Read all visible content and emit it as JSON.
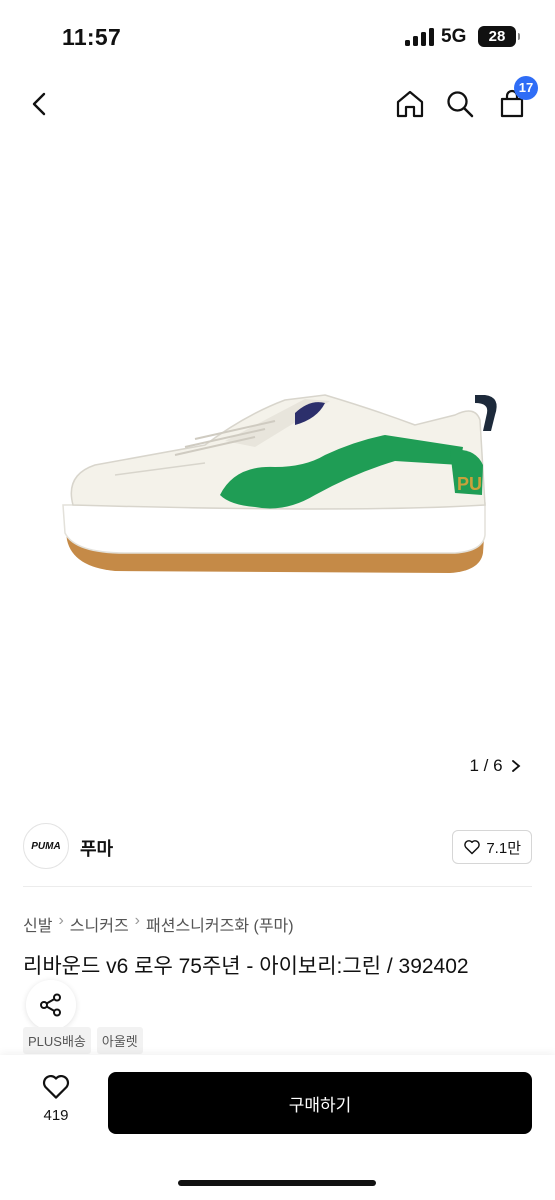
{
  "status_bar": {
    "time": "11:57",
    "network": "5G",
    "battery": "28"
  },
  "nav": {
    "cart_count": "17"
  },
  "image_pager": {
    "text": "1 / 6"
  },
  "brand": {
    "logo_text": "PUMA",
    "name": "푸마",
    "likes": "7.1만"
  },
  "breadcrumb": [
    "신발",
    "스니커즈",
    "패션스니커즈화 (푸마)"
  ],
  "product": {
    "title": "리바운드 v6 로우 75주년 - 아이보리:그린 / 392402",
    "tags": [
      "PLUS배송",
      "아울렛"
    ]
  },
  "bottom_bar": {
    "wish_count": "419",
    "buy_label": "구매하기"
  },
  "colors": {
    "badge": "#2f6df6",
    "buy_button": "#000000",
    "accent_green": "#1f9d55"
  }
}
